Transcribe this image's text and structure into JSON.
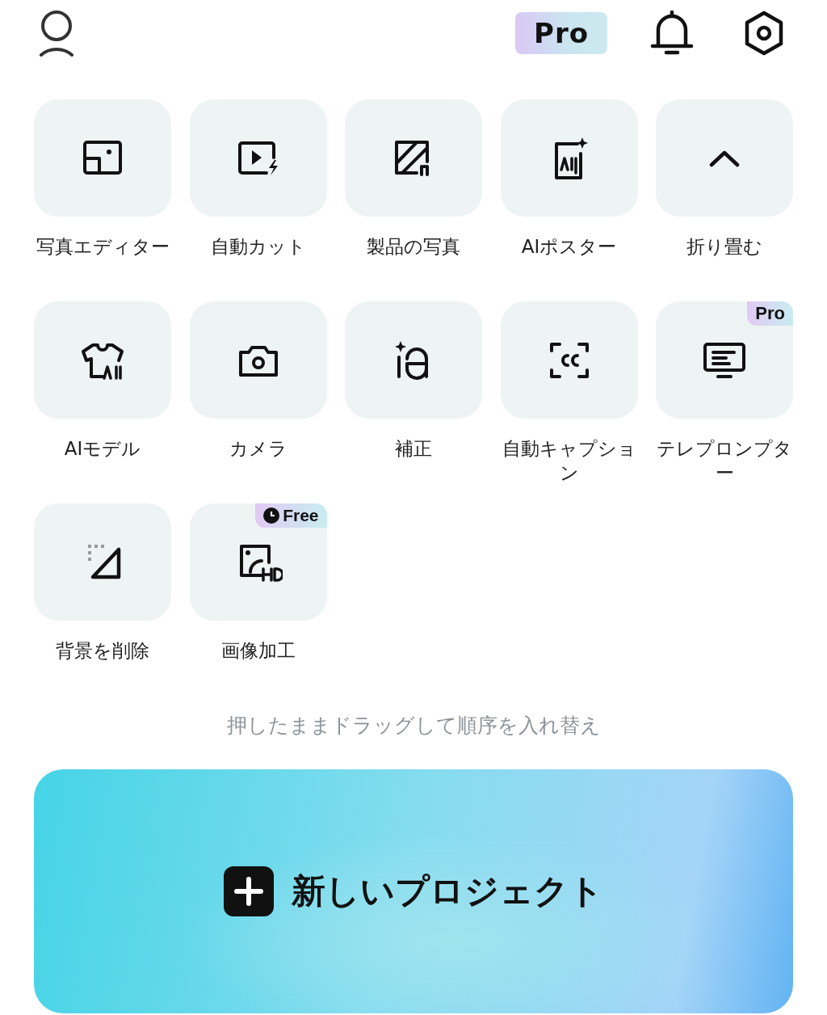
{
  "header": {
    "pro_badge": "Pro"
  },
  "tools": [
    {
      "label": "写真エディター"
    },
    {
      "label": "自動カット"
    },
    {
      "label": "製品の写真"
    },
    {
      "label": "AIポスター"
    },
    {
      "label": "折り畳む"
    },
    {
      "label": "AIモデル"
    },
    {
      "label": "カメラ"
    },
    {
      "label": "補正"
    },
    {
      "label": "自動キャプション"
    },
    {
      "label": "テレプロンプター",
      "badge": {
        "kind": "pro",
        "text": "Pro"
      }
    },
    {
      "label": "背景を削除"
    },
    {
      "label": "画像加工",
      "badge": {
        "kind": "free",
        "text": "Free"
      }
    }
  ],
  "hint": "押したままドラッグして順序を入れ替え",
  "new_project": {
    "label": "新しいプロジェクト"
  }
}
